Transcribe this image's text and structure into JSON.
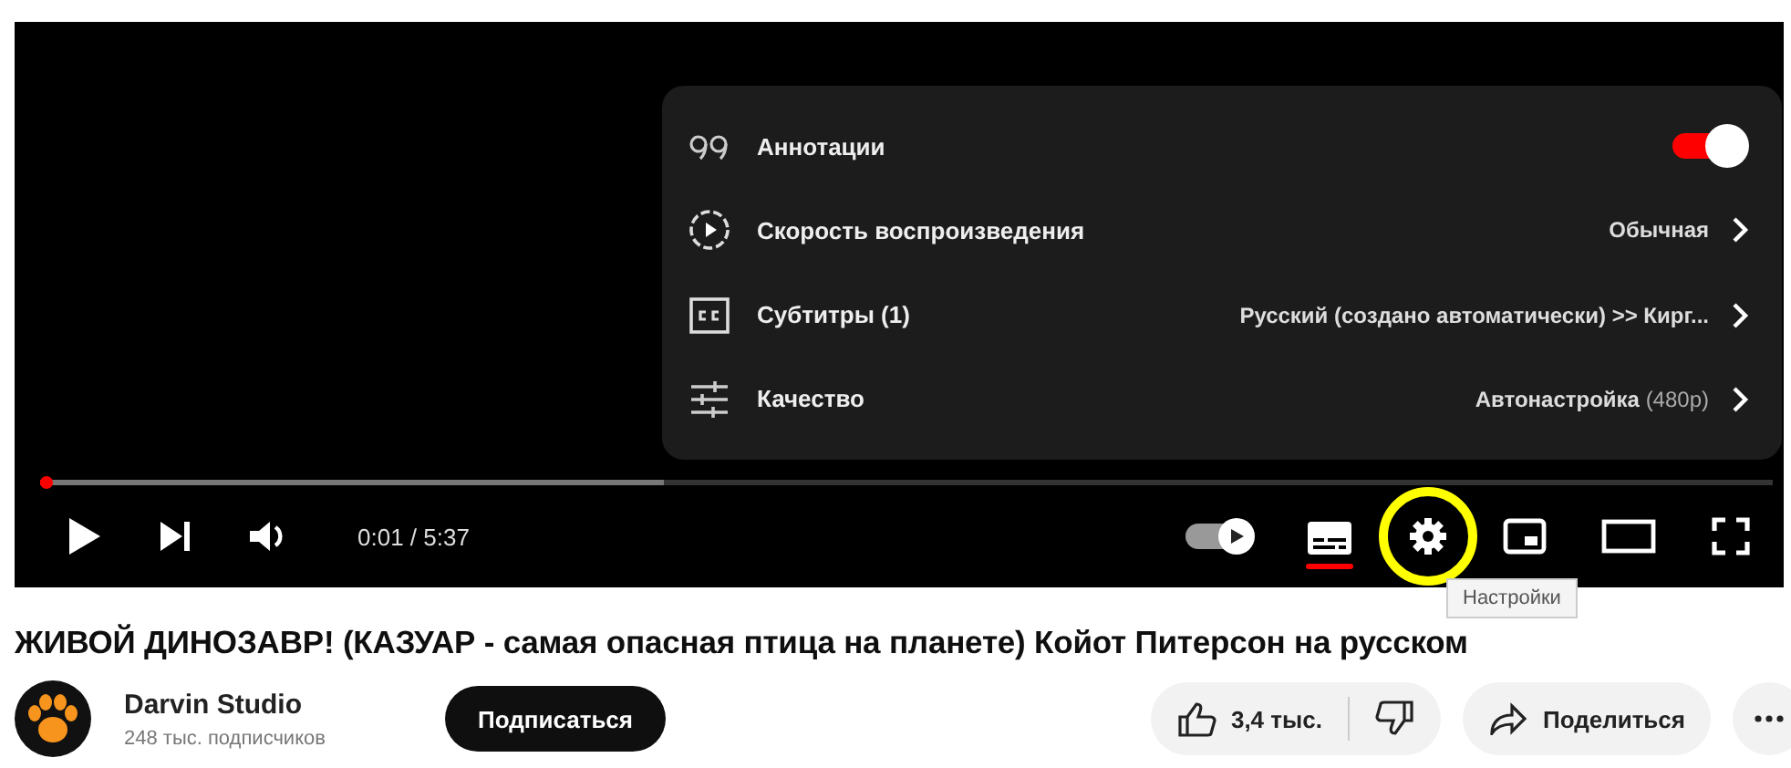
{
  "player": {
    "settings_menu": [
      {
        "kind": "toggle",
        "label": "Аннотации",
        "on": true
      },
      {
        "kind": "submenu",
        "label": "Скорость воспроизведения",
        "value": "Обычная"
      },
      {
        "kind": "submenu",
        "label": "Субтитры (1)",
        "value": "Русский (создано автоматически) >> Кирг..."
      },
      {
        "kind": "submenu",
        "label": "Качество",
        "value": "Автонастройка",
        "value_note": "(480p)"
      }
    ],
    "progress": {
      "level": 0.003
    },
    "buffer": {
      "level": 0.36
    },
    "time": "0:01 / 5:37",
    "autoplay": {
      "on": true
    },
    "subtitles": {
      "on": true
    },
    "settings_highlighted": true,
    "tooltip": "Настройки"
  },
  "video_title": "ЖИВОЙ ДИНОЗАВР! (КАЗУАР - самая опасная птица на планете) Койот Питерсон на русском",
  "channel": {
    "name": "Darvin Studio",
    "subscribers": "248 тыс. подписчиков",
    "subscribe_button": "Подписаться"
  },
  "actions": {
    "likes": "3,4 тыс.",
    "share": "Поделиться"
  }
}
